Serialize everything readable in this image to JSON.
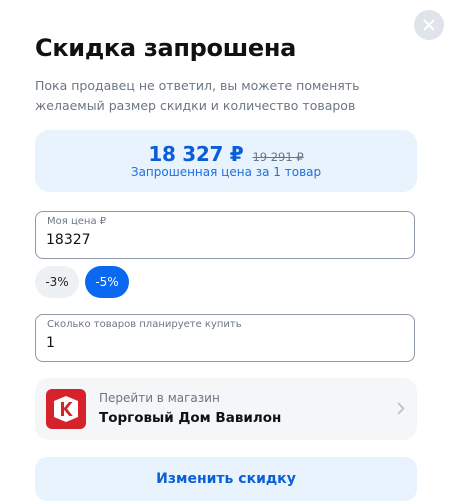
{
  "dialog": {
    "title": "Скидка запрошена",
    "subtitle": "Пока продавец не ответил, вы можете поменять желаемый размер скидки и количество товаров",
    "close_icon": "close-icon"
  },
  "price": {
    "current": "18 327 ₽",
    "old": "19 291 ₽",
    "caption": "Запрошенная цена за 1 товар"
  },
  "my_price_field": {
    "label": "Моя цена ₽",
    "value": "18327"
  },
  "discount_chips": [
    {
      "label": "-3%",
      "selected": false
    },
    {
      "label": "-5%",
      "selected": true
    }
  ],
  "quantity_field": {
    "label": "Сколько товаров планируете купить",
    "value": "1"
  },
  "store": {
    "hint": "Перейти в магазин",
    "name": "Торговый Дом Вавилон",
    "logo_icon": "store-logo-icon",
    "chevron_icon": "chevron-right-icon"
  },
  "actions": {
    "submit_label": "Изменить скидку"
  },
  "colors": {
    "accent": "#0b68f0",
    "accent_text": "#0a5fd6",
    "card_bg": "#e8f3fd",
    "store_logo": "#d6222a"
  }
}
